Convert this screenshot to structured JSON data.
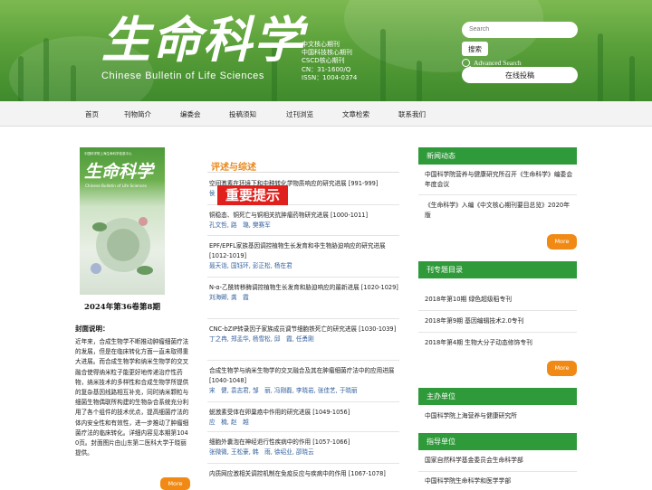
{
  "header": {
    "logo_cn": "生命科学",
    "logo_en": "Chinese Bulletin of Life Sciences",
    "badges": [
      "中文核心期刊",
      "中国科技核心期刊",
      "CSCD核心期刊",
      "CN：31-1600/Q",
      "ISSN：1004-0374"
    ]
  },
  "search": {
    "placeholder": "Search",
    "button": "搜索",
    "advanced": "Advanced Search",
    "online_submit": "在线投稿"
  },
  "nav": [
    "首页",
    "刊物简介",
    "编委会",
    "投稿须知",
    "过刊浏览",
    "文章检索",
    "联系我们"
  ],
  "left": {
    "cover": {
      "title": "生命科学",
      "en": "Chinese Bulletin of Life Sciences",
      "small": "中国科学院上海生命科学信息中心"
    },
    "issue": "2024年第36卷第8期",
    "cover_title": "封面说明：",
    "cover_desc": "近年来，合成生物学不断推动肿瘤细菌疗法的发展，但是在临床转化方面一直未取得重大进展。而合成生物学和纳米生物学的交叉融合使得纳米粒子能更好地传递治疗性药物，纳米技术的多样性和合成生物学所提供的复杂基因线路相互补充，同时纳米颗粒与细菌生物偶联所构建的生物杂合系统充分利用了各个组件的技术优点，提高细菌疗法的体内安全性和有效性，进一步推动了肿瘤细菌疗法的临床转化。详细内容见本期第1040页。封面图片由山东第二医科大学于晓丽提供。",
    "more": "More"
  },
  "main": {
    "section_title": "评述与综述",
    "notice": "重要提示",
    "articles": [
      {
        "title": "空间激素在环境下和中种转化学物质响应的研究进展 [991-999]",
        "authors": "侯　毛兰群"
      },
      {
        "title": "铜稳态、铜死亡与铜相关抗肿瘤药物研究进展 [1000-1011]",
        "authors": "孔文哲, 路　璐, 樊赛军"
      },
      {
        "title": "EPF/EPFL家族基因调控植物生长发育和非生物胁迫响应的研究进展 [1012-1019]",
        "authors": "聂天诣, 国钰环, 彭正松, 杨在君"
      },
      {
        "title": "N-α-乙酰转移酶调控植物生长发育和胁迫响应的最新进展 [1020-1029]",
        "authors": "刘海卿, 龚　霞"
      },
      {
        "title": "CNC-bZIP转录因子家族成员调节细胞铁死亡的研究进展 [1030-1039]",
        "authors": "丁之冉, 郑孟华, 杨雪松, 邱　霞, 任勇刚"
      },
      {
        "title": "合成生物学与纳米生物学的交叉融合及其在肿瘤细菌疗法中的应用进展 [1040-1048]",
        "authors": "宋　健, 袁志君, 邹　丽, 冯刚磊, 李晓岩, 张佳艺, 于晓丽"
      },
      {
        "title": "蜕激素受体在卵巢癌中作用的研究进展 [1049-1056]",
        "authors": "应　楠, 赵　越"
      },
      {
        "title": "细胞外囊泡在神经退行性疾病中的作用 [1057-1066]",
        "authors": "张微微, 王松豪, 韩　雨, 徐绍业, 邵晓云"
      },
      {
        "title": "内质网应激相关调控机制在免疫反应与疾病中的作用 [1067-1078]",
        "authors": ""
      }
    ]
  },
  "right": {
    "news": {
      "title": "新闻动态",
      "items": [
        "中国科学院营养与健康研究所召开《生命科学》编委会年度会议",
        "《生命科学》入编《中文核心期刊要目总览》2020年版"
      ],
      "more": "More"
    },
    "special": {
      "title": "刊专题目录",
      "items": [
        "2018年第10期 绿色超级稻专刊",
        "2018年第9期 基因编辑技术2.0专刊",
        "2018年第4期 生物大分子动态修饰专刊"
      ],
      "more": "More"
    },
    "host": {
      "title": "主办单位",
      "items": [
        "中国科学院上海营养与健康研究所"
      ]
    },
    "guide": {
      "title": "指导单位",
      "items": [
        "国家自然科学基金委员会生命科学部",
        "中国科学院生命科学和医学学部"
      ]
    }
  }
}
